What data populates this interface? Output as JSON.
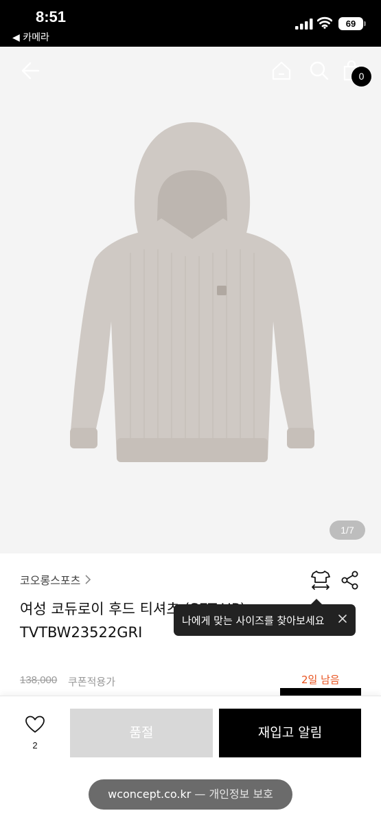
{
  "status_bar": {
    "time": "8:51",
    "back_app": "◀ 카메라",
    "battery": "69"
  },
  "gallery": {
    "cart_count": "0",
    "page_indicator": "1/7"
  },
  "product": {
    "brand": "코오롱스포츠",
    "title": "여성 코듀로이 후드 티셔츠 (SET-UP) TVTBW23522GRI",
    "price_original": "138,000",
    "coupon_label": "쿠폰적용가",
    "days_left": "2일 남음"
  },
  "tooltip": {
    "text": "나에게 맞는 사이즈를 찾아보세요"
  },
  "bottom_bar": {
    "like_count": "2",
    "soldout_label": "품절",
    "restock_label": "재입고 알림"
  },
  "browser": {
    "domain": "wconcept.co.kr",
    "suffix": " — 개인정보 보호"
  },
  "colors": {
    "accent_orange": "#e8521e",
    "hoodie": "#cfc9c4",
    "cta_black": "#000000",
    "disabled_gray": "#d8d8d8"
  },
  "icons": {
    "back": "arrow-left-icon",
    "home": "home-icon",
    "search": "search-icon",
    "cart": "shopping-bag-icon",
    "size": "shirt-size-icon",
    "share": "share-icon",
    "like": "heart-icon",
    "close": "close-icon"
  }
}
